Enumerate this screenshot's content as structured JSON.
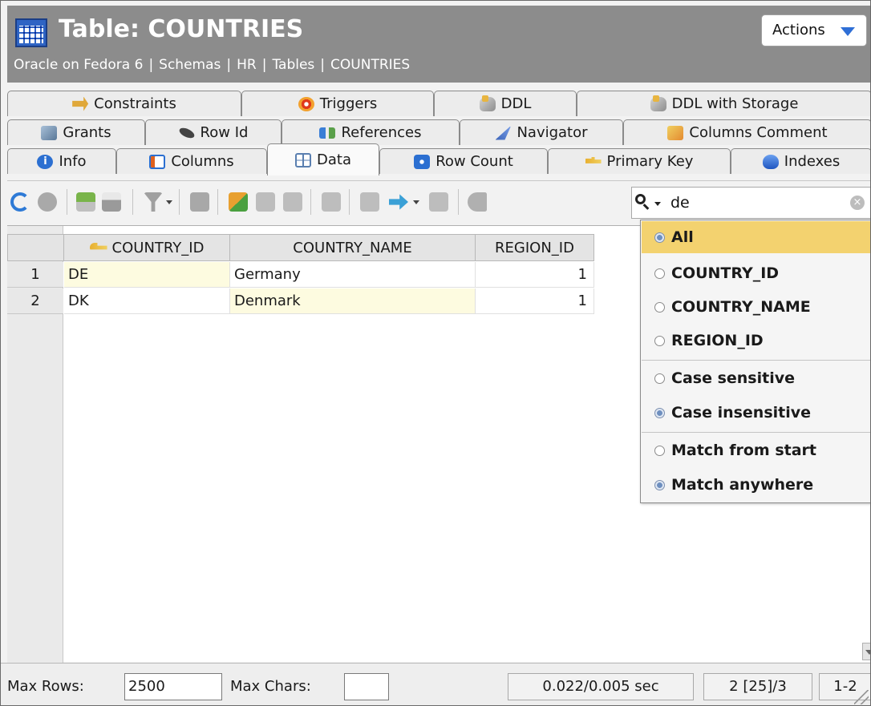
{
  "header": {
    "title": "Table: COUNTRIES",
    "breadcrumb": [
      "Oracle on Fedora 6",
      "Schemas",
      "HR",
      "Tables",
      "COUNTRIES"
    ],
    "actions_label": "Actions"
  },
  "tabs": {
    "row1": [
      {
        "label": "Constraints",
        "icon": "constraint-icon"
      },
      {
        "label": "Triggers",
        "icon": "trigger-icon"
      },
      {
        "label": "DDL",
        "icon": "ddl-icon"
      },
      {
        "label": "DDL with Storage",
        "icon": "ddl-storage-icon"
      }
    ],
    "row2": [
      {
        "label": "Grants",
        "icon": "grants-icon"
      },
      {
        "label": "Row Id",
        "icon": "rowid-icon"
      },
      {
        "label": "References",
        "icon": "references-icon"
      },
      {
        "label": "Navigator",
        "icon": "navigator-icon"
      },
      {
        "label": "Columns Comment",
        "icon": "columns-comment-icon"
      }
    ],
    "row3": [
      {
        "label": "Info",
        "icon": "info-icon"
      },
      {
        "label": "Columns",
        "icon": "columns-icon"
      },
      {
        "label": "Data",
        "icon": "data-grid-icon",
        "active": true
      },
      {
        "label": "Row Count",
        "icon": "row-count-icon"
      },
      {
        "label": "Primary Key",
        "icon": "primary-key-icon"
      },
      {
        "label": "Indexes",
        "icon": "indexes-icon"
      }
    ]
  },
  "search": {
    "value": "de",
    "menu": {
      "columns": [
        {
          "label": "All",
          "checked": true
        },
        {
          "label": "COUNTRY_ID",
          "checked": false
        },
        {
          "label": "COUNTRY_NAME",
          "checked": false
        },
        {
          "label": "REGION_ID",
          "checked": false
        }
      ],
      "case": [
        {
          "label": "Case sensitive",
          "checked": false
        },
        {
          "label": "Case insensitive",
          "checked": true
        }
      ],
      "match": [
        {
          "label": "Match from start",
          "checked": false
        },
        {
          "label": "Match anywhere",
          "checked": true
        }
      ]
    }
  },
  "grid": {
    "columns": [
      "COUNTRY_ID",
      "COUNTRY_NAME",
      "REGION_ID"
    ],
    "rows": [
      {
        "num": "1",
        "country_id": "DE",
        "country_name": "Germany",
        "region_id": "1"
      },
      {
        "num": "2",
        "country_id": "DK",
        "country_name": "Denmark",
        "region_id": "1"
      }
    ]
  },
  "status": {
    "max_rows_label": "Max Rows:",
    "max_rows_value": "2500",
    "max_chars_label": "Max Chars:",
    "max_chars_value": "",
    "timing": "0.022/0.005 sec",
    "row_info": "2 [25]/3",
    "range": "1-2"
  },
  "colors": {
    "header_bg": "#8c8c8c",
    "menu_selected": "#f3d26f",
    "highlight_cell": "#fdfbe0",
    "accent_blue": "#2f6fd6"
  }
}
